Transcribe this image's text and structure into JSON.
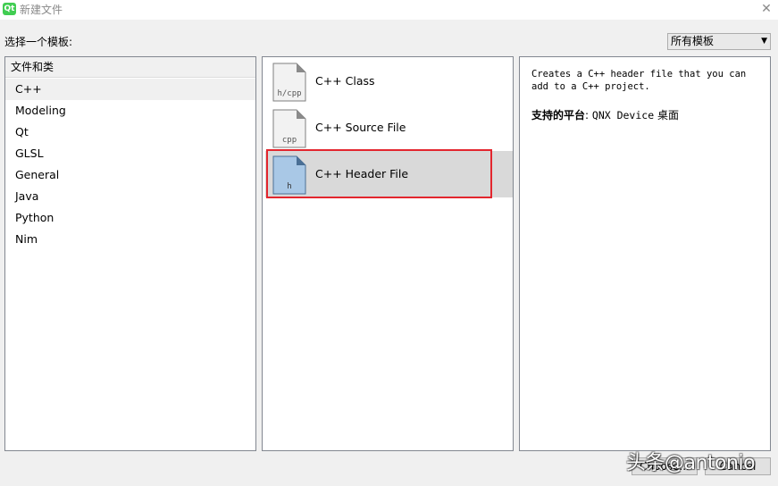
{
  "window": {
    "title": "新建文件",
    "close_icon": "close-icon"
  },
  "choose_label": "选择一个模板:",
  "filter": {
    "selected": "所有模板"
  },
  "categories": {
    "header": "文件和类",
    "items": [
      {
        "label": "C++",
        "selected": true
      },
      {
        "label": "Modeling"
      },
      {
        "label": "Qt"
      },
      {
        "label": "GLSL"
      },
      {
        "label": "General"
      },
      {
        "label": "Java"
      },
      {
        "label": "Python"
      },
      {
        "label": "Nim"
      }
    ]
  },
  "templates": [
    {
      "label": "C++ Class",
      "icon_text": "h/cpp",
      "icon": "class-file-icon"
    },
    {
      "label": "C++ Source File",
      "icon_text": "cpp",
      "icon": "source-file-icon"
    },
    {
      "label": "C++ Header File",
      "icon_text": "h",
      "icon": "header-file-icon",
      "selected": true,
      "highlight_color": "#e3262e"
    }
  ],
  "description": {
    "text": "Creates a C++ header file that you can add to a C++ project.",
    "platforms_label": "支持的平台",
    "platforms_colon": ":",
    "platforms_value": "QNX Device",
    "platforms_suffix": "桌面"
  },
  "buttons": {
    "choose": "Choose...",
    "cancel": "Cancel"
  },
  "watermark": "头条@antonio"
}
